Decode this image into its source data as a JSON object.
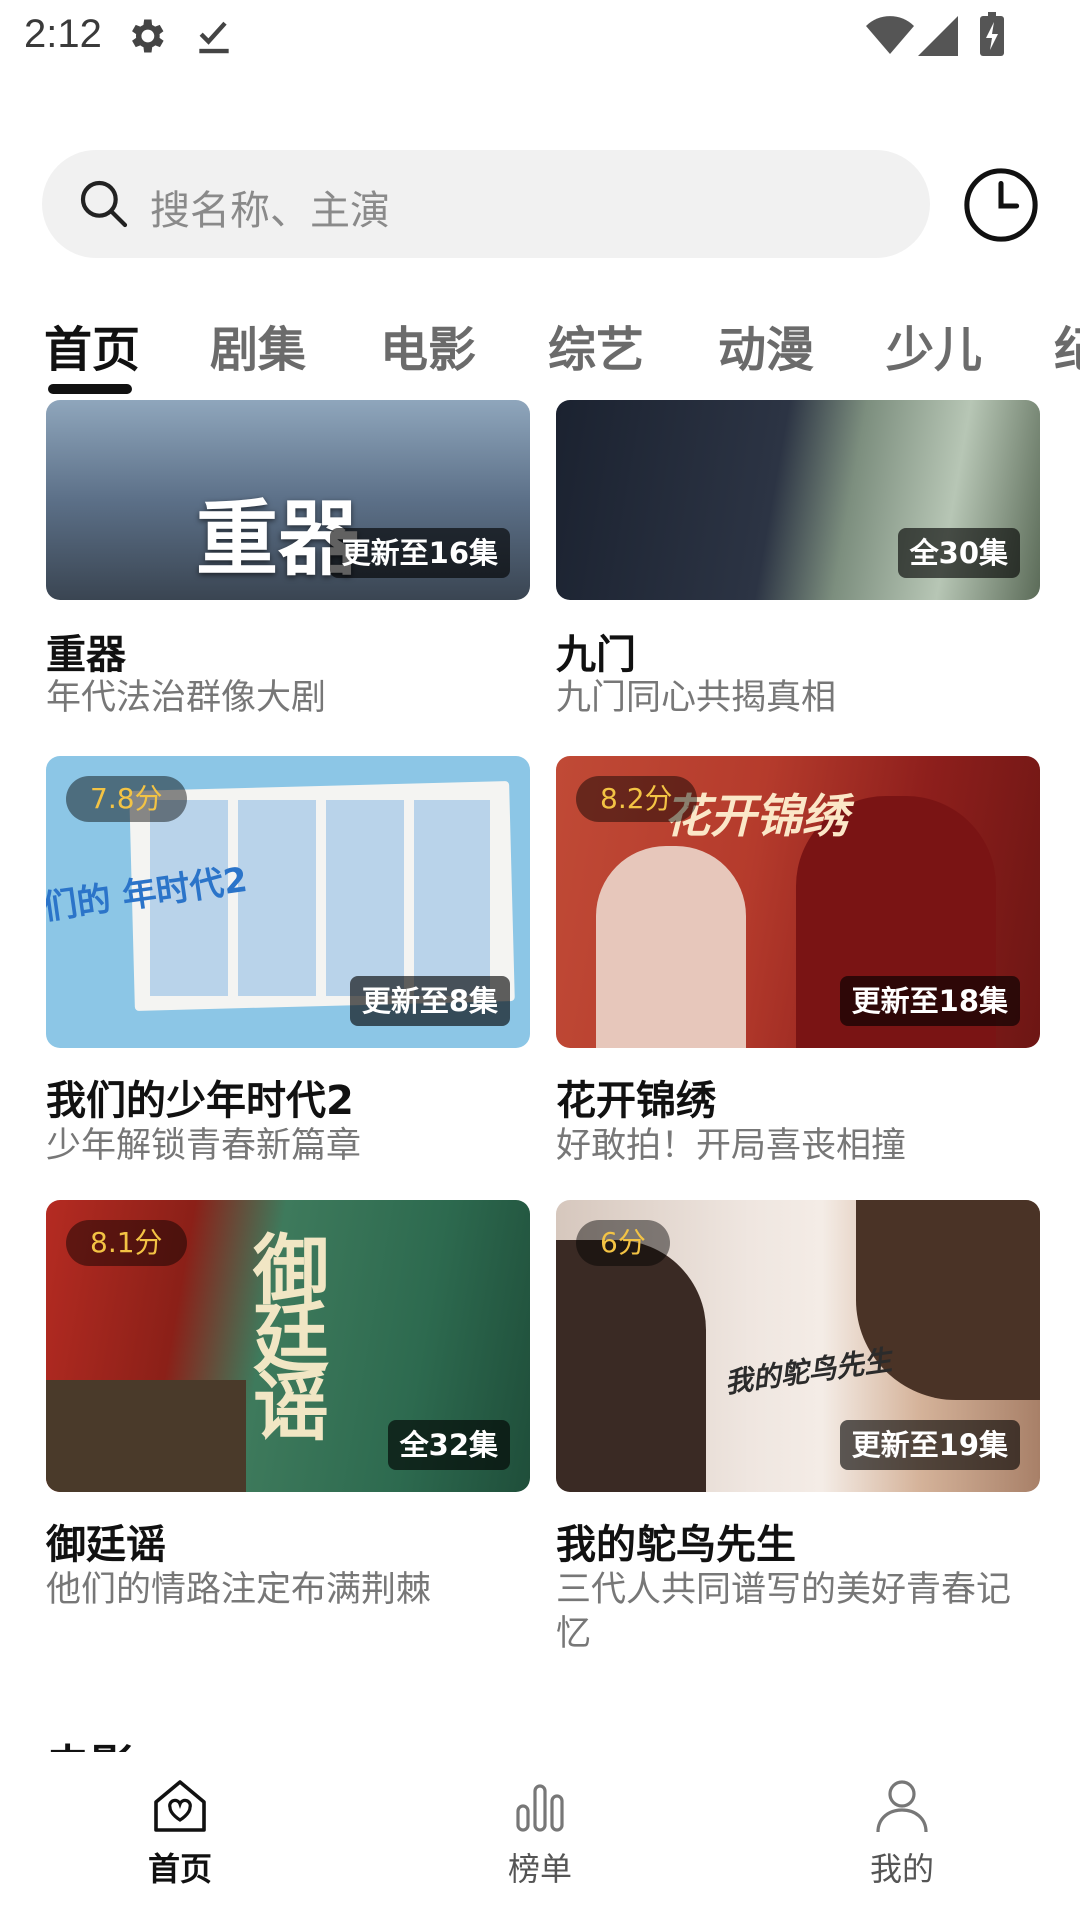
{
  "status_bar": {
    "time": "2:12",
    "icons": [
      "settings-gear-icon",
      "download-done-icon",
      "wifi-icon",
      "cell-signal-icon",
      "battery-charging-icon"
    ]
  },
  "search": {
    "placeholder": "搜名称、主演"
  },
  "tabs": [
    {
      "label": "首页",
      "active": true
    },
    {
      "label": "剧集",
      "active": false
    },
    {
      "label": "电影",
      "active": false
    },
    {
      "label": "综艺",
      "active": false
    },
    {
      "label": "动漫",
      "active": false
    },
    {
      "label": "少儿",
      "active": false
    },
    {
      "label": "纪",
      "active": false
    }
  ],
  "cards": [
    {
      "title": "重器",
      "subtitle": "年代法治群像大剧",
      "score": "",
      "episodes": "更新至16集",
      "poster_text": "重器"
    },
    {
      "title": "九门",
      "subtitle": "九门同心共揭真相",
      "score": "",
      "episodes": "全30集",
      "poster_text": ""
    },
    {
      "title": "我们的少年时代2",
      "subtitle": "少年解锁青春新篇章",
      "score": "7.8分",
      "episodes": "更新至8集",
      "poster_text": "们的 年时代2"
    },
    {
      "title": "花开锦绣",
      "subtitle": "好敢拍！开局喜丧相撞",
      "score": "8.2分",
      "episodes": "更新至18集",
      "poster_text": "花开锦绣"
    },
    {
      "title": "御廷谣",
      "subtitle": "他们的情路注定布满荆棘",
      "score": "8.1分",
      "episodes": "全32集",
      "poster_text": "御廷谣"
    },
    {
      "title": "我的鸵鸟先生",
      "subtitle": "三代人共同谱写的美好青春记忆",
      "score": "6分",
      "episodes": "更新至19集",
      "poster_text": "我的鸵鸟先生"
    }
  ],
  "section_peek": "电影",
  "bottom_nav": [
    {
      "label": "首页",
      "icon": "home-heart-icon",
      "active": true
    },
    {
      "label": "榜单",
      "icon": "ranking-bars-icon",
      "active": false
    },
    {
      "label": "我的",
      "icon": "profile-icon",
      "active": false
    }
  ],
  "colors": {
    "score_text": "#f3c344",
    "active_text": "#111111",
    "inactive_text": "#6b6b6b",
    "search_bg": "#f1f1f1"
  }
}
